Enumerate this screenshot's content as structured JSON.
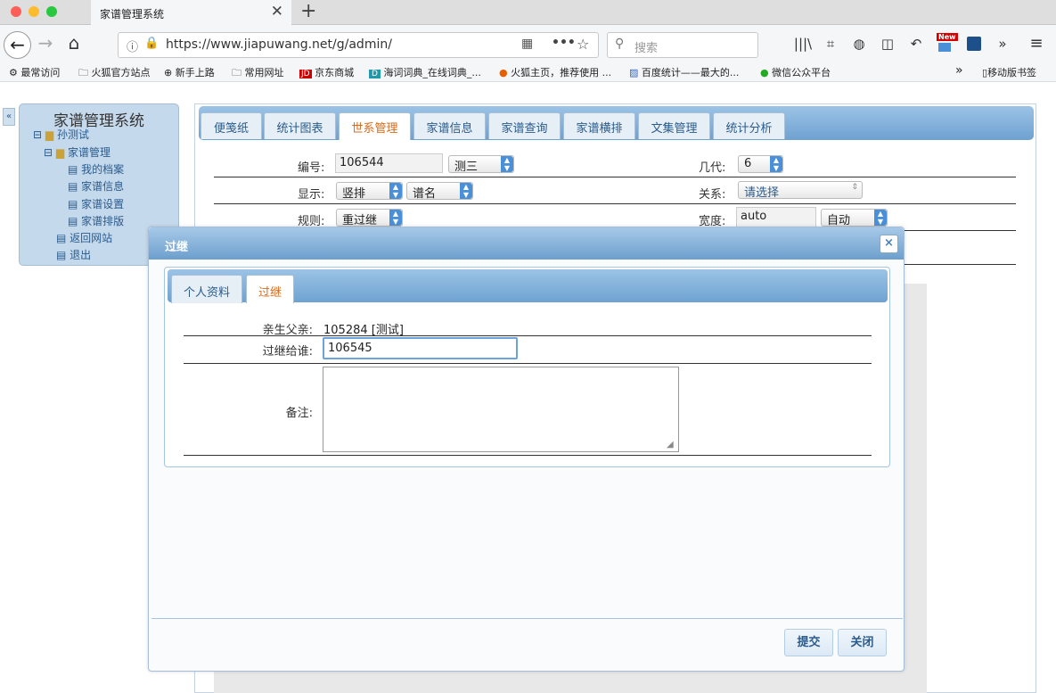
{
  "browser": {
    "tab_title": "家谱管理系统",
    "url": "https://www.jiapuwang.net/g/admin/",
    "search_placeholder": "搜索",
    "new_badge": "New",
    "bookmarks": [
      "最常访问",
      "火狐官方站点",
      "新手上路",
      "常用网址",
      "京东商城",
      "海词词典_在线词典_...",
      "火狐主页，推荐使用 ...",
      "百度统计——最大的...",
      "微信公众平台"
    ],
    "mobile_bookmarks": "移动版书签"
  },
  "sidebar": {
    "collapse_glyph": "«",
    "title": "家谱管理系统",
    "tree": {
      "root": "孙测试",
      "group": "家谱管理",
      "items": [
        "我的档案",
        "家谱信息",
        "家谱设置",
        "家谱排版"
      ],
      "links": [
        "返回网站",
        "退出"
      ]
    }
  },
  "main_tabs": [
    "便笺纸",
    "统计图表",
    "世系管理",
    "家谱信息",
    "家谱查询",
    "家谱横排",
    "文集管理",
    "统计分析"
  ],
  "active_main_tab": "世系管理",
  "form": {
    "number_label": "编号:",
    "number_value": "106544",
    "name_select": "测三",
    "generation_label": "几代:",
    "generation_value": "6",
    "display_label": "显示:",
    "display_value": "竖排",
    "display_mode": "谱名",
    "relation_label": "关系:",
    "relation_value": "请选择",
    "rule_label": "规则:",
    "rule_value": "重过继",
    "width_label": "宽度:",
    "width_value": "auto",
    "width_mode": "自动"
  },
  "dialog": {
    "title": "过继",
    "close_glyph": "×",
    "tabs": [
      "个人资料",
      "过继"
    ],
    "active_tab": "过继",
    "father_label": "亲生父亲:",
    "father_value": "105284 [测试]",
    "adopt_label": "过继给谁:",
    "adopt_value": "106545",
    "note_label": "备注:",
    "note_value": "",
    "submit": "提交",
    "close": "关闭"
  },
  "colors": {
    "accent": "#6ea2d1",
    "active_tab_text": "#d76a1a",
    "link": "#2a5b8c"
  }
}
